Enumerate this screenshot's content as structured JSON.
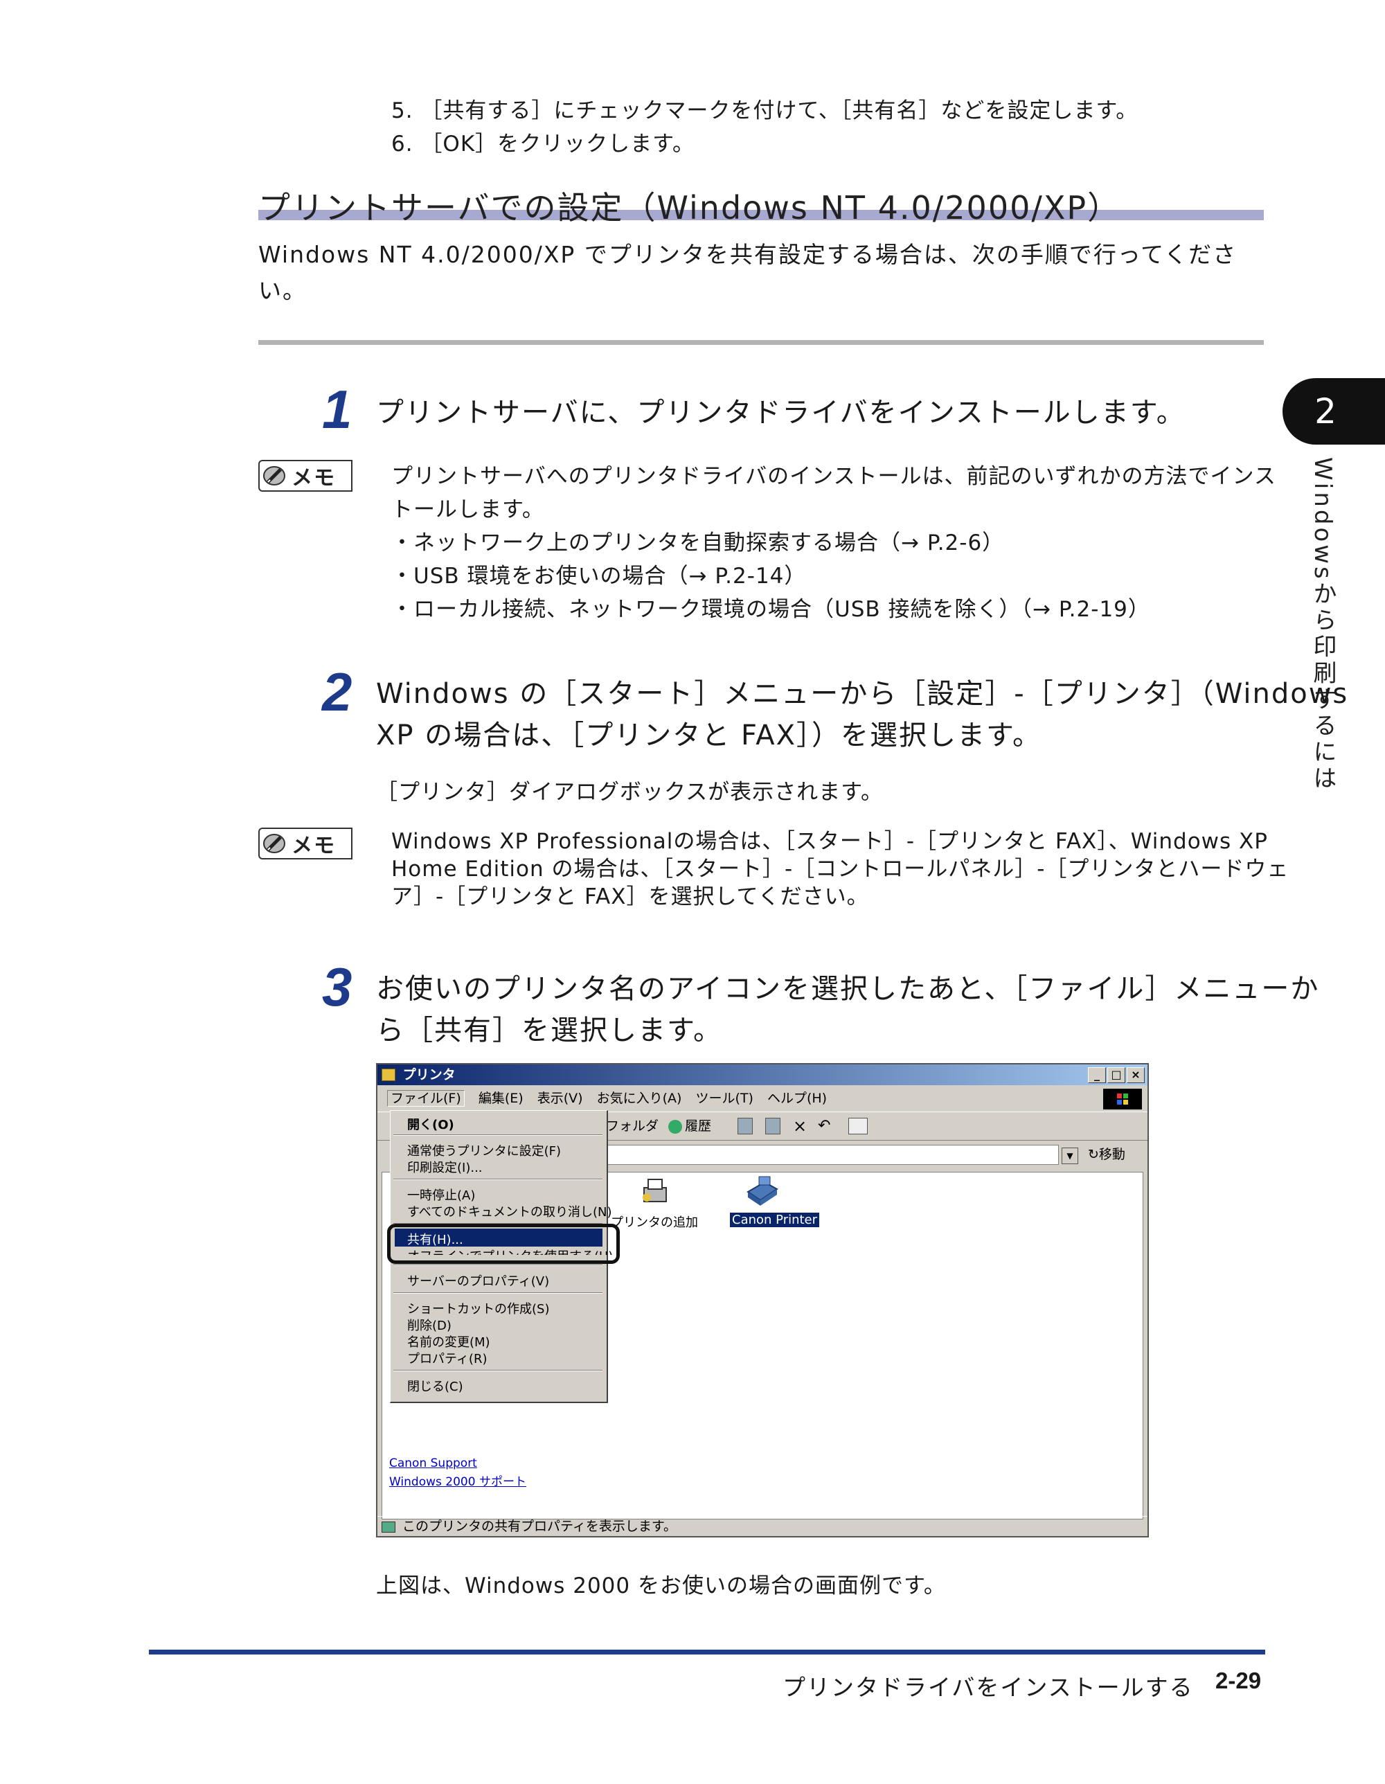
{
  "top_steps": [
    "5. ［共有する］にチェックマークを付けて、［共有名］などを設定します。",
    "6. ［OK］をクリックします。"
  ],
  "section": {
    "title": "プリントサーバでの設定（Windows NT 4.0/2000/XP）",
    "intro": "Windows NT 4.0/2000/XP でプリンタを共有設定する場合は、次の手順で行ってください。"
  },
  "chapter": {
    "number": "2",
    "side_label": "Windowsから印刷するには"
  },
  "steps": [
    {
      "num": "1",
      "text": "プリントサーバに、プリンタドライバをインストールします。"
    },
    {
      "num": "2",
      "line1": "Windows の［スタート］メニューから［設定］-［プリンタ］（Windows",
      "line2": "XP の場合は、［プリンタと FAX］）を選択します。",
      "sub": "［プリンタ］ダイアログボックスが表示されます。"
    },
    {
      "num": "3",
      "line1": "お使いのプリンタ名のアイコンを選択したあと、［ファイル］メニューか",
      "line2": "ら［共有］を選択します。"
    }
  ],
  "memo_label": "メモ",
  "memo1": {
    "line1": "プリントサーバへのプリンタドライバのインストールは、前記のいずれかの方法でインス",
    "line2": "トールします。",
    "bullets": [
      "・ネットワーク上のプリンタを自動探索する場合（→ P.2-6）",
      "・USB 環境をお使いの場合（→ P.2-14）",
      "・ローカル接続、ネットワーク環境の場合（USB 接続を除く）（→ P.2-19）"
    ]
  },
  "memo2": {
    "line1": "Windows XP Professionalの場合は、［スタート］-［プリンタと FAX］、Windows XP",
    "line2": "Home Edition の場合は、［スタート］-［コントロールパネル］-［プリンタとハードウェ",
    "line3": "ア］-［プリンタと FAX］を選択してください。"
  },
  "screenshot": {
    "window_title": "プリンタ",
    "menu": [
      "ファイル(F)",
      "編集(E)",
      "表示(V)",
      "お気に入り(A)",
      "ツール(T)",
      "ヘルプ(H)"
    ],
    "toolbar_folder": "フォルダ",
    "toolbar_history": "履歴",
    "address_go": "移動",
    "file_menu": {
      "open": "開く(O)",
      "set_default": "通常使うプリンタに設定(F)",
      "print_settings": "印刷設定(I)...",
      "pause": "一時停止(A)",
      "cancel_all": "すべてのドキュメントの取り消し(N)",
      "share": "共有(H)...",
      "offline": "オフラインでプリンタを使用する(U)",
      "server_properties": "サーバーのプロパティ(V)",
      "create_shortcut": "ショートカットの作成(S)",
      "delete": "削除(D)",
      "rename": "名前の変更(M)",
      "properties": "プロパティ(R)",
      "close": "閉じる(C)"
    },
    "icons": [
      {
        "label": "プリンタの追加"
      },
      {
        "label": "Canon Printer"
      }
    ],
    "links": [
      "Canon Support",
      "Windows 2000 サポート"
    ],
    "status": "このプリンタの共有プロパティを表示します。"
  },
  "caption": "上図は、Windows 2000 をお使いの場合の画面例です。",
  "footer": {
    "title": "プリンタドライバをインストールする",
    "page": "2-29"
  }
}
